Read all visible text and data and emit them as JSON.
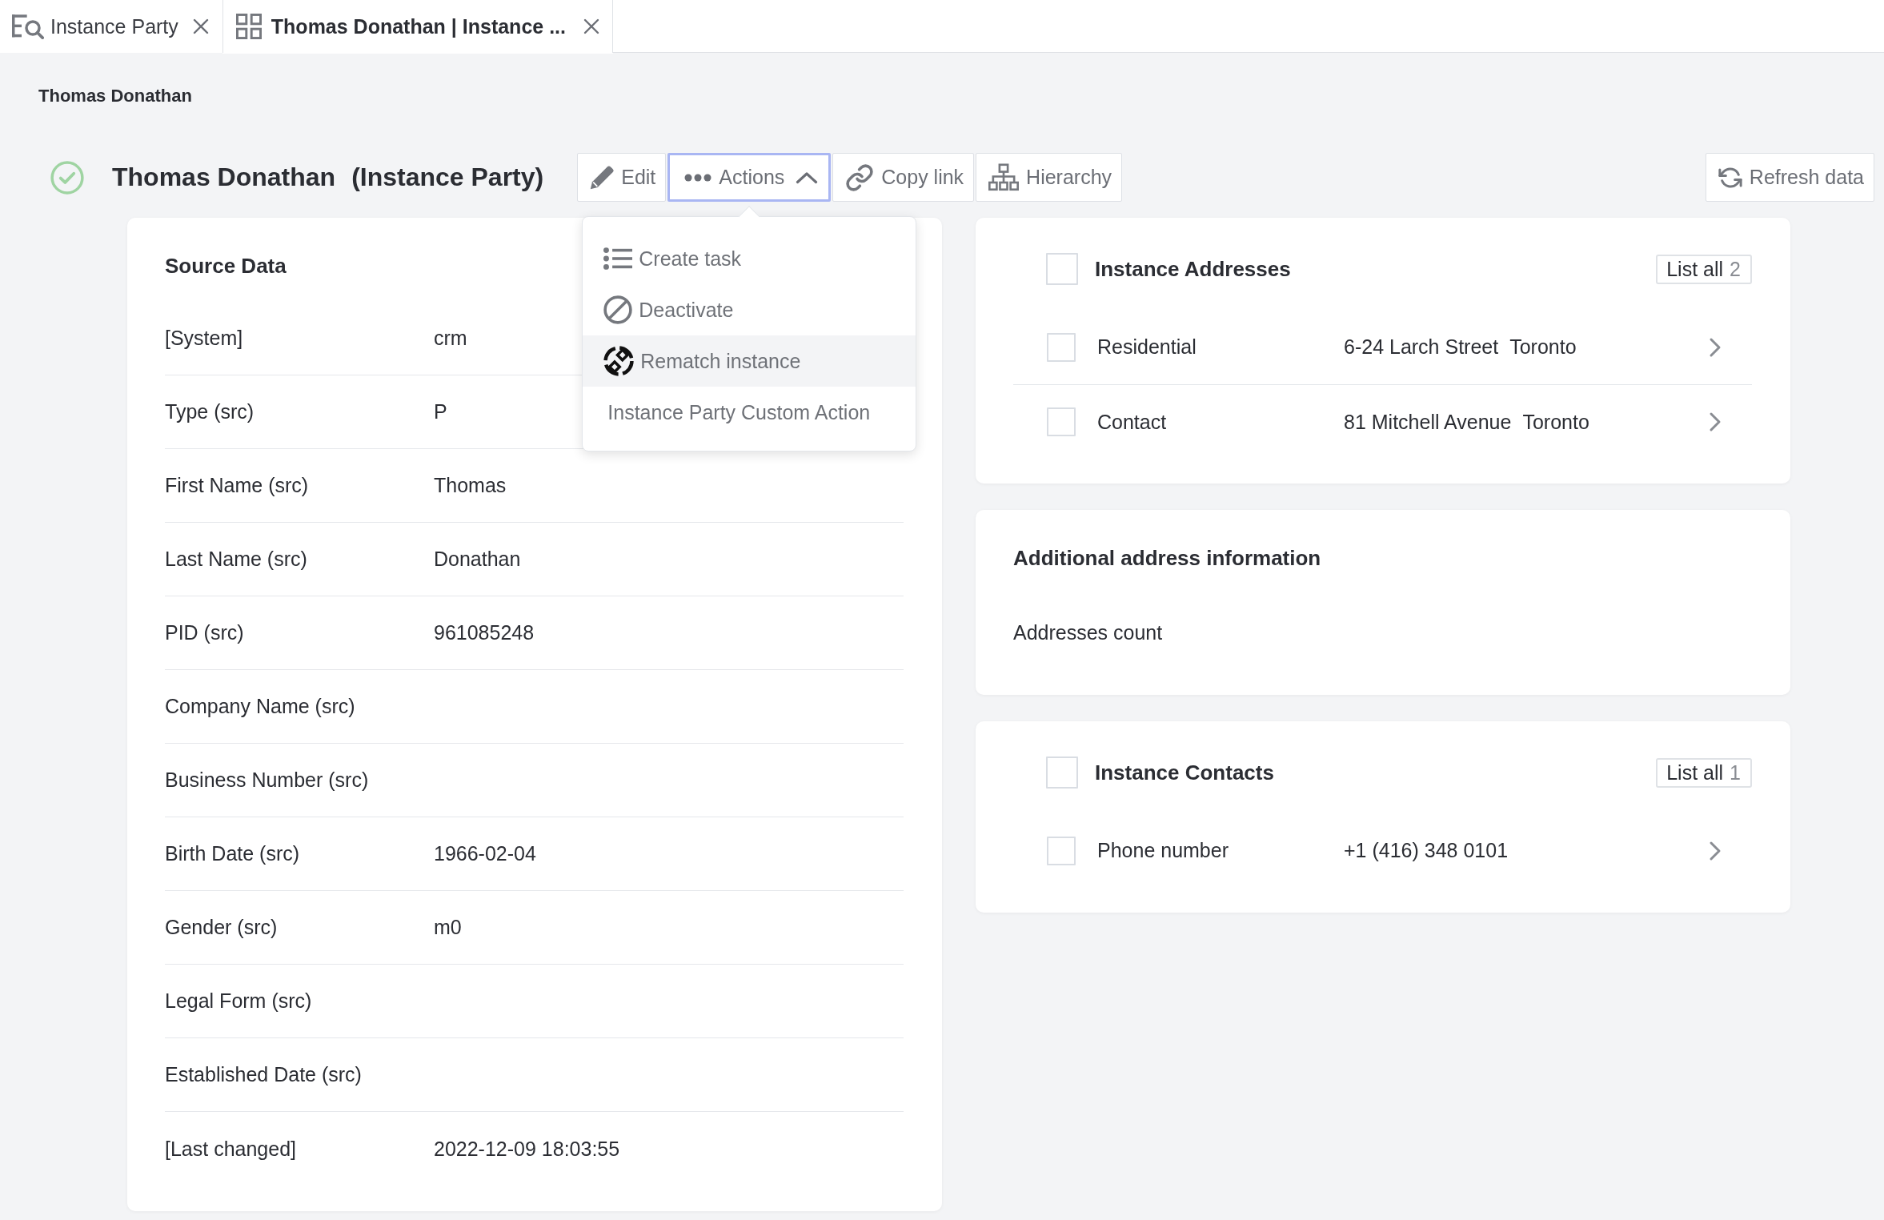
{
  "tabs": [
    {
      "label": "Instance Party",
      "kind": "search",
      "selected": false
    },
    {
      "label": "Thomas Donathan | Instance ...",
      "kind": "record",
      "selected": true
    }
  ],
  "breadcrumb": "Thomas Donathan",
  "header": {
    "active": true,
    "name": "Thomas Donathan",
    "entity_type": "(Instance Party)"
  },
  "toolbar": [
    {
      "label": "Edit",
      "kind": "edit",
      "expanded": false
    },
    {
      "label": "Actions",
      "kind": "actions",
      "expanded": true
    },
    {
      "label": "Copy link",
      "kind": "link",
      "expanded": false
    },
    {
      "label": "Hierarchy",
      "kind": "hierarchy",
      "expanded": false
    }
  ],
  "refresh_button": "Refresh data",
  "actions_menu": [
    {
      "label": "Create task",
      "kind": "task",
      "selected": false
    },
    {
      "label": "Deactivate",
      "kind": "deactivate",
      "selected": false
    },
    {
      "label": "Rematch instance",
      "kind": "rematch",
      "selected": true
    },
    {
      "label": "Instance Party Custom Action",
      "kind": "custom",
      "selected": false
    }
  ],
  "source_data": {
    "title": "Source Data",
    "fields": [
      {
        "label": "[System]",
        "value": "crm"
      },
      {
        "label": "Type (src)",
        "value": "P"
      },
      {
        "label": "First Name (src)",
        "value": "Thomas"
      },
      {
        "label": "Last Name (src)",
        "value": "Donathan"
      },
      {
        "label": "PID (src)",
        "value": "961085248"
      },
      {
        "label": "Company Name (src)"
      },
      {
        "label": "Business Number (src)"
      },
      {
        "label": "Birth Date (src)",
        "value": "1966-02-04"
      },
      {
        "label": "Gender (src)",
        "value": "m0"
      },
      {
        "label": "Legal Form (src)"
      },
      {
        "label": "Established Date (src)"
      },
      {
        "label": "[Last changed]",
        "value": "2022-12-09 18:03:55"
      }
    ]
  },
  "instance_addresses": {
    "checked": false,
    "title": "Instance Addresses",
    "list_all": {
      "label": "List all",
      "count": "2"
    },
    "rows": [
      {
        "checked": false,
        "type": "Residential",
        "values": [
          "6-24 Larch Street",
          "Toronto"
        ]
      },
      {
        "checked": false,
        "type": "Contact",
        "values": [
          "81 Mitchell Avenue",
          "Toronto"
        ]
      }
    ]
  },
  "additional_address_information": {
    "title": "Additional address information",
    "fields": [
      {
        "label": "Addresses count"
      }
    ]
  },
  "instance_contacts": {
    "checked": false,
    "title": "Instance Contacts",
    "list_all": {
      "label": "List all",
      "count": "1"
    },
    "rows": [
      {
        "checked": false,
        "type": "Phone number",
        "values": [
          "+1 (416) 348 0101"
        ]
      }
    ]
  }
}
